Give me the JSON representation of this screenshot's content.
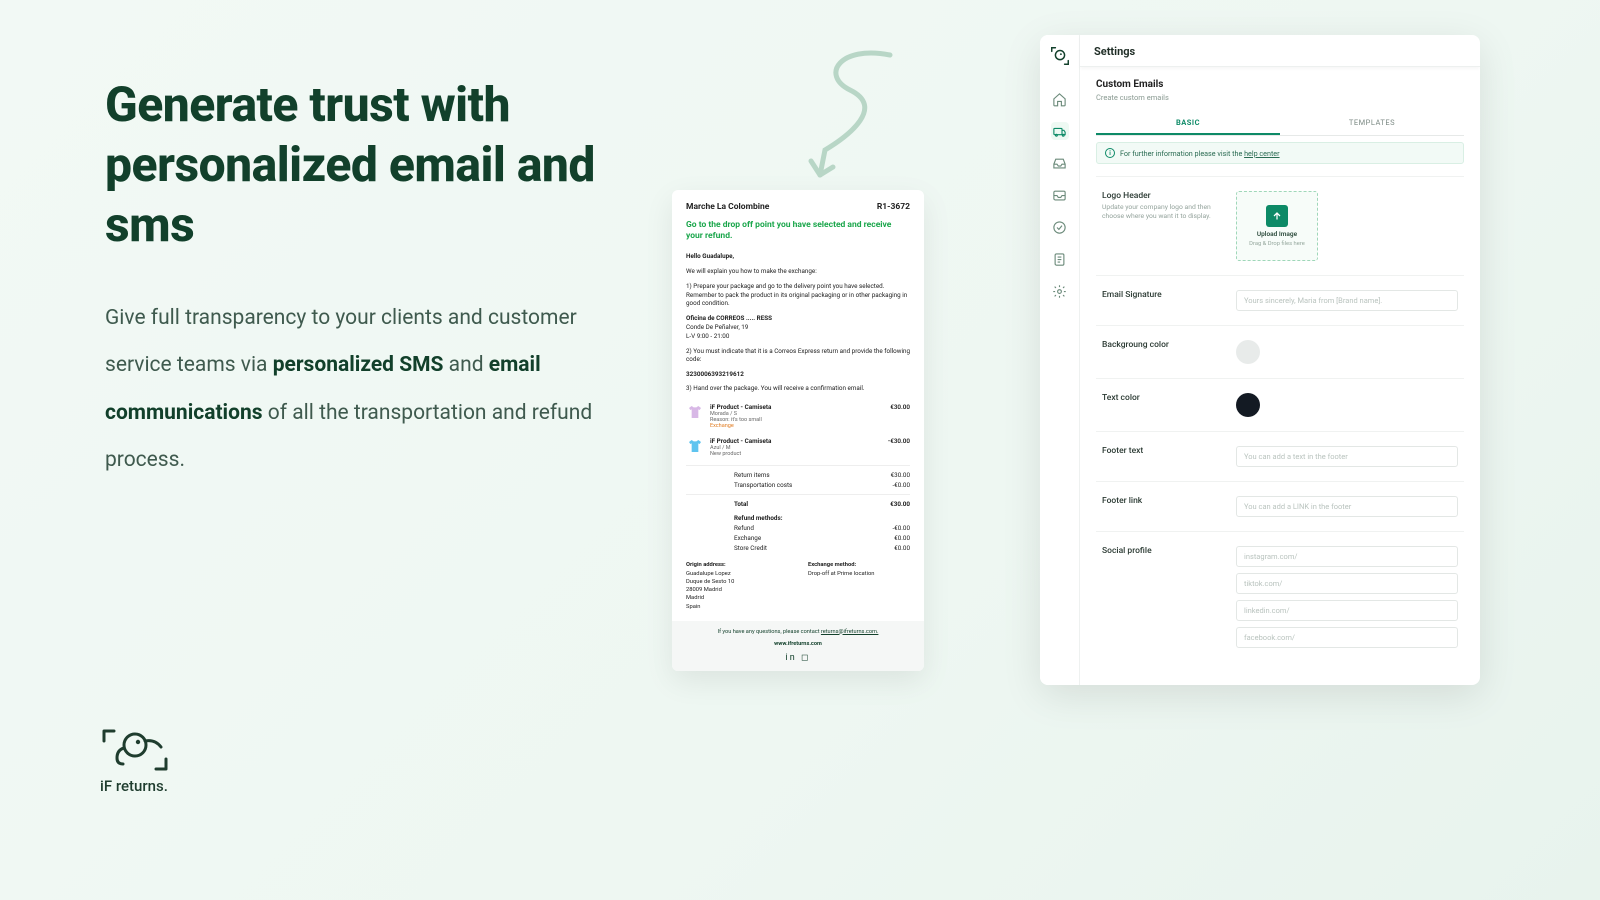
{
  "marketing": {
    "headline": "Generate trust with personalized email and sms",
    "body_pre": "Give full transparency to your clients and customer service teams via ",
    "body_bold1": "personalized SMS",
    "body_mid": " and ",
    "body_bold2": "email communications",
    "body_post": " of all the transportation and refund process."
  },
  "brand": {
    "name": "iF returns."
  },
  "email": {
    "store": "Marche La Colombine",
    "order": "R1-3672",
    "title": "Go to the drop off point you have selected and receive your refund.",
    "greeting": "Hello Guadalupe,",
    "intro": "We will explain you how to make the exchange:",
    "step1": "1) Prepare your package and go to the delivery point you have selected. Remember to pack the product in its original packaging or in other packaging in good condition.",
    "pickup_name": "Oficina de CORREOS ..... RESS",
    "pickup_addr": "Conde De Peñalver, 19",
    "pickup_hours": "L-V 9:00 - 21:00",
    "step2": "2) You must indicate that it is a Correos Express return and provide the following code:",
    "code": "3230006393219612",
    "step3": "3) Hand over the package. You will receive a confirmation email.",
    "products": [
      {
        "name": "iF Product - Camiseta",
        "variant": "Morada / S",
        "reason": "Reason: it's too small",
        "exchange": "Exchange",
        "price": "€30.00",
        "color": "#d8b8e6"
      },
      {
        "name": "iF Product - Camiseta",
        "variant": "Azul / M",
        "reason": "New product",
        "exchange": "",
        "price": "-€30.00",
        "color": "#5fc4ef"
      }
    ],
    "totals": {
      "return_items_l": "Return items",
      "return_items_v": "€30.00",
      "transport_l": "Transportation costs",
      "transport_v": "-€0.00",
      "total_l": "Total",
      "total_v": "€30.00",
      "methods_h": "Refund methods:",
      "refund_l": "Refund",
      "refund_v": "-€0.00",
      "exchange_l": "Exchange",
      "exchange_v": "€0.00",
      "credit_l": "Store Credit",
      "credit_v": "€0.00"
    },
    "origin": {
      "h": "Origin address:",
      "l1": "Guadalupe Lopez",
      "l2": "Duque de Sesto 10",
      "l3": "28009 Madrid",
      "l4": "Madrid",
      "l5": "Spain"
    },
    "method": {
      "h": "Exchange method:",
      "v": "Drop-off at Prime location"
    },
    "footer": {
      "q": "If you have any questions, please contact ",
      "mail": "returns@ifreturns.com.",
      "site": "www.ifreturns.com"
    }
  },
  "app": {
    "title": "Settings",
    "section": "Custom Emails",
    "subtitle": "Create custom emails",
    "tabs": {
      "basic": "BASIC",
      "templates": "TEMPLATES"
    },
    "banner_pre": "For further information please visit the ",
    "banner_link": "help center",
    "logo": {
      "label": "Logo Header",
      "hint": "Update your company logo and then choose where you want it to display.",
      "upload_t1": "Upload Image",
      "upload_t2": "Drag & Drop files here"
    },
    "signature": {
      "label": "Email Signature",
      "placeholder": "Yours sincerely, Maria from [Brand name]."
    },
    "bg": {
      "label": "Backgroung color"
    },
    "text": {
      "label": "Text color"
    },
    "footer_t": {
      "label": "Footer text",
      "placeholder": "You can add a text in the footer"
    },
    "footer_l": {
      "label": "Footer link",
      "placeholder": "You can add a LINK in the footer"
    },
    "social": {
      "label": "Social profile",
      "ig": "instagram.com/",
      "tk": "tiktok.com/",
      "li": "linkedin.com/",
      "fb": "facebook.com/"
    }
  }
}
